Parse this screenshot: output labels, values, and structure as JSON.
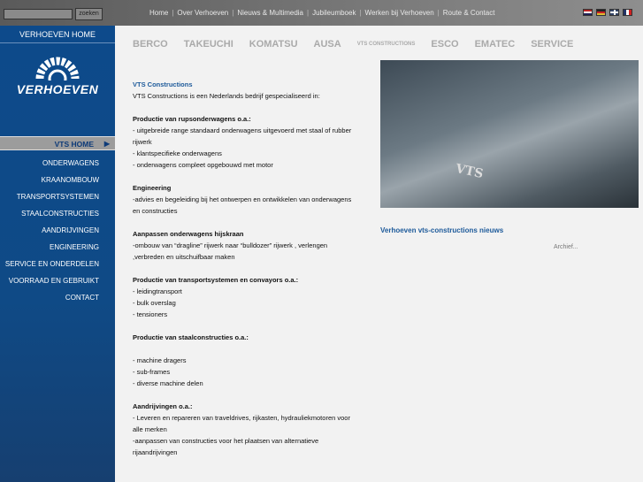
{
  "search": {
    "button": "zoeken",
    "value": ""
  },
  "topnav": [
    "Home",
    "Over Verhoeven",
    "Nieuws & Multimedia",
    "Jubileumboek",
    "Werken bij Verhoeven",
    "Route & Contact"
  ],
  "flags": [
    "nl",
    "de",
    "en",
    "fr"
  ],
  "sidebar": {
    "home": "VERHOEVEN HOME",
    "logo": "VERHOEVEN",
    "active": "VTS HOME",
    "items": [
      "ONDERWAGENS",
      "KRAANOMBOUW",
      "TRANSPORTSYSTEMEN",
      "STAALCONSTRUCTIES",
      "AANDRIJVINGEN",
      "ENGINEERING",
      "SERVICE EN ONDERDELEN",
      "VOORRAAD EN GEBRUIKT",
      "CONTACT"
    ]
  },
  "logos": [
    "BERCO",
    "TAKEUCHI",
    "KOMATSU",
    "AUSA",
    "VTS CONSTRUCTIONS",
    "ESCO",
    "EMATEC",
    "SERVICE"
  ],
  "content": {
    "title": "VTS Constructions",
    "intro": "VTS Constructions is een Nederlands bedrijf gespecialiseerd in:",
    "sections": [
      {
        "heading": "Productie van rupsonderwagens o.a.:",
        "lines": [
          "- uitgebreide range standaard onderwagens   uitgevoerd met staal of rubber rijwerk",
          "- klantspecifieke onderwagens",
          "- onderwagens compleet opgebouwd met motor"
        ]
      },
      {
        "heading": "Engineering",
        "lines": [
          "-advies en begeleiding bij het ontwerpen en ontwikkelen van onderwagens en constructies"
        ]
      },
      {
        "heading": "Aanpassen onderwagens hijskraan",
        "lines": [
          "-ombouw van “dragline” rijwerk naar “bulldozer” rijwerk , verlengen ,verbreden en uitschuifbaar maken"
        ]
      },
      {
        "heading": "Productie van transportsystemen en convayors o.a.:",
        "lines": [
          "- leidingtransport",
          "- bulk overslag",
          "- tensioners"
        ]
      },
      {
        "heading": "Productie van staalconstructies o.a.:",
        "lines": [
          "",
          "- machine dragers",
          "- sub-frames",
          "- diverse machine delen"
        ]
      },
      {
        "heading": "Aandrijvingen o.a.:",
        "lines": [
          "- Leveren en repareren van traveldrives, rijkasten, hydrauliekmotoren voor alle merken",
          "-aanpassen van constructies voor het plaatsen van alternatieve rijaandrijvingen"
        ]
      }
    ]
  },
  "photo_text": "VTS",
  "news": {
    "heading": "Verhoeven vts-constructions nieuws",
    "archive": "Archief..."
  }
}
